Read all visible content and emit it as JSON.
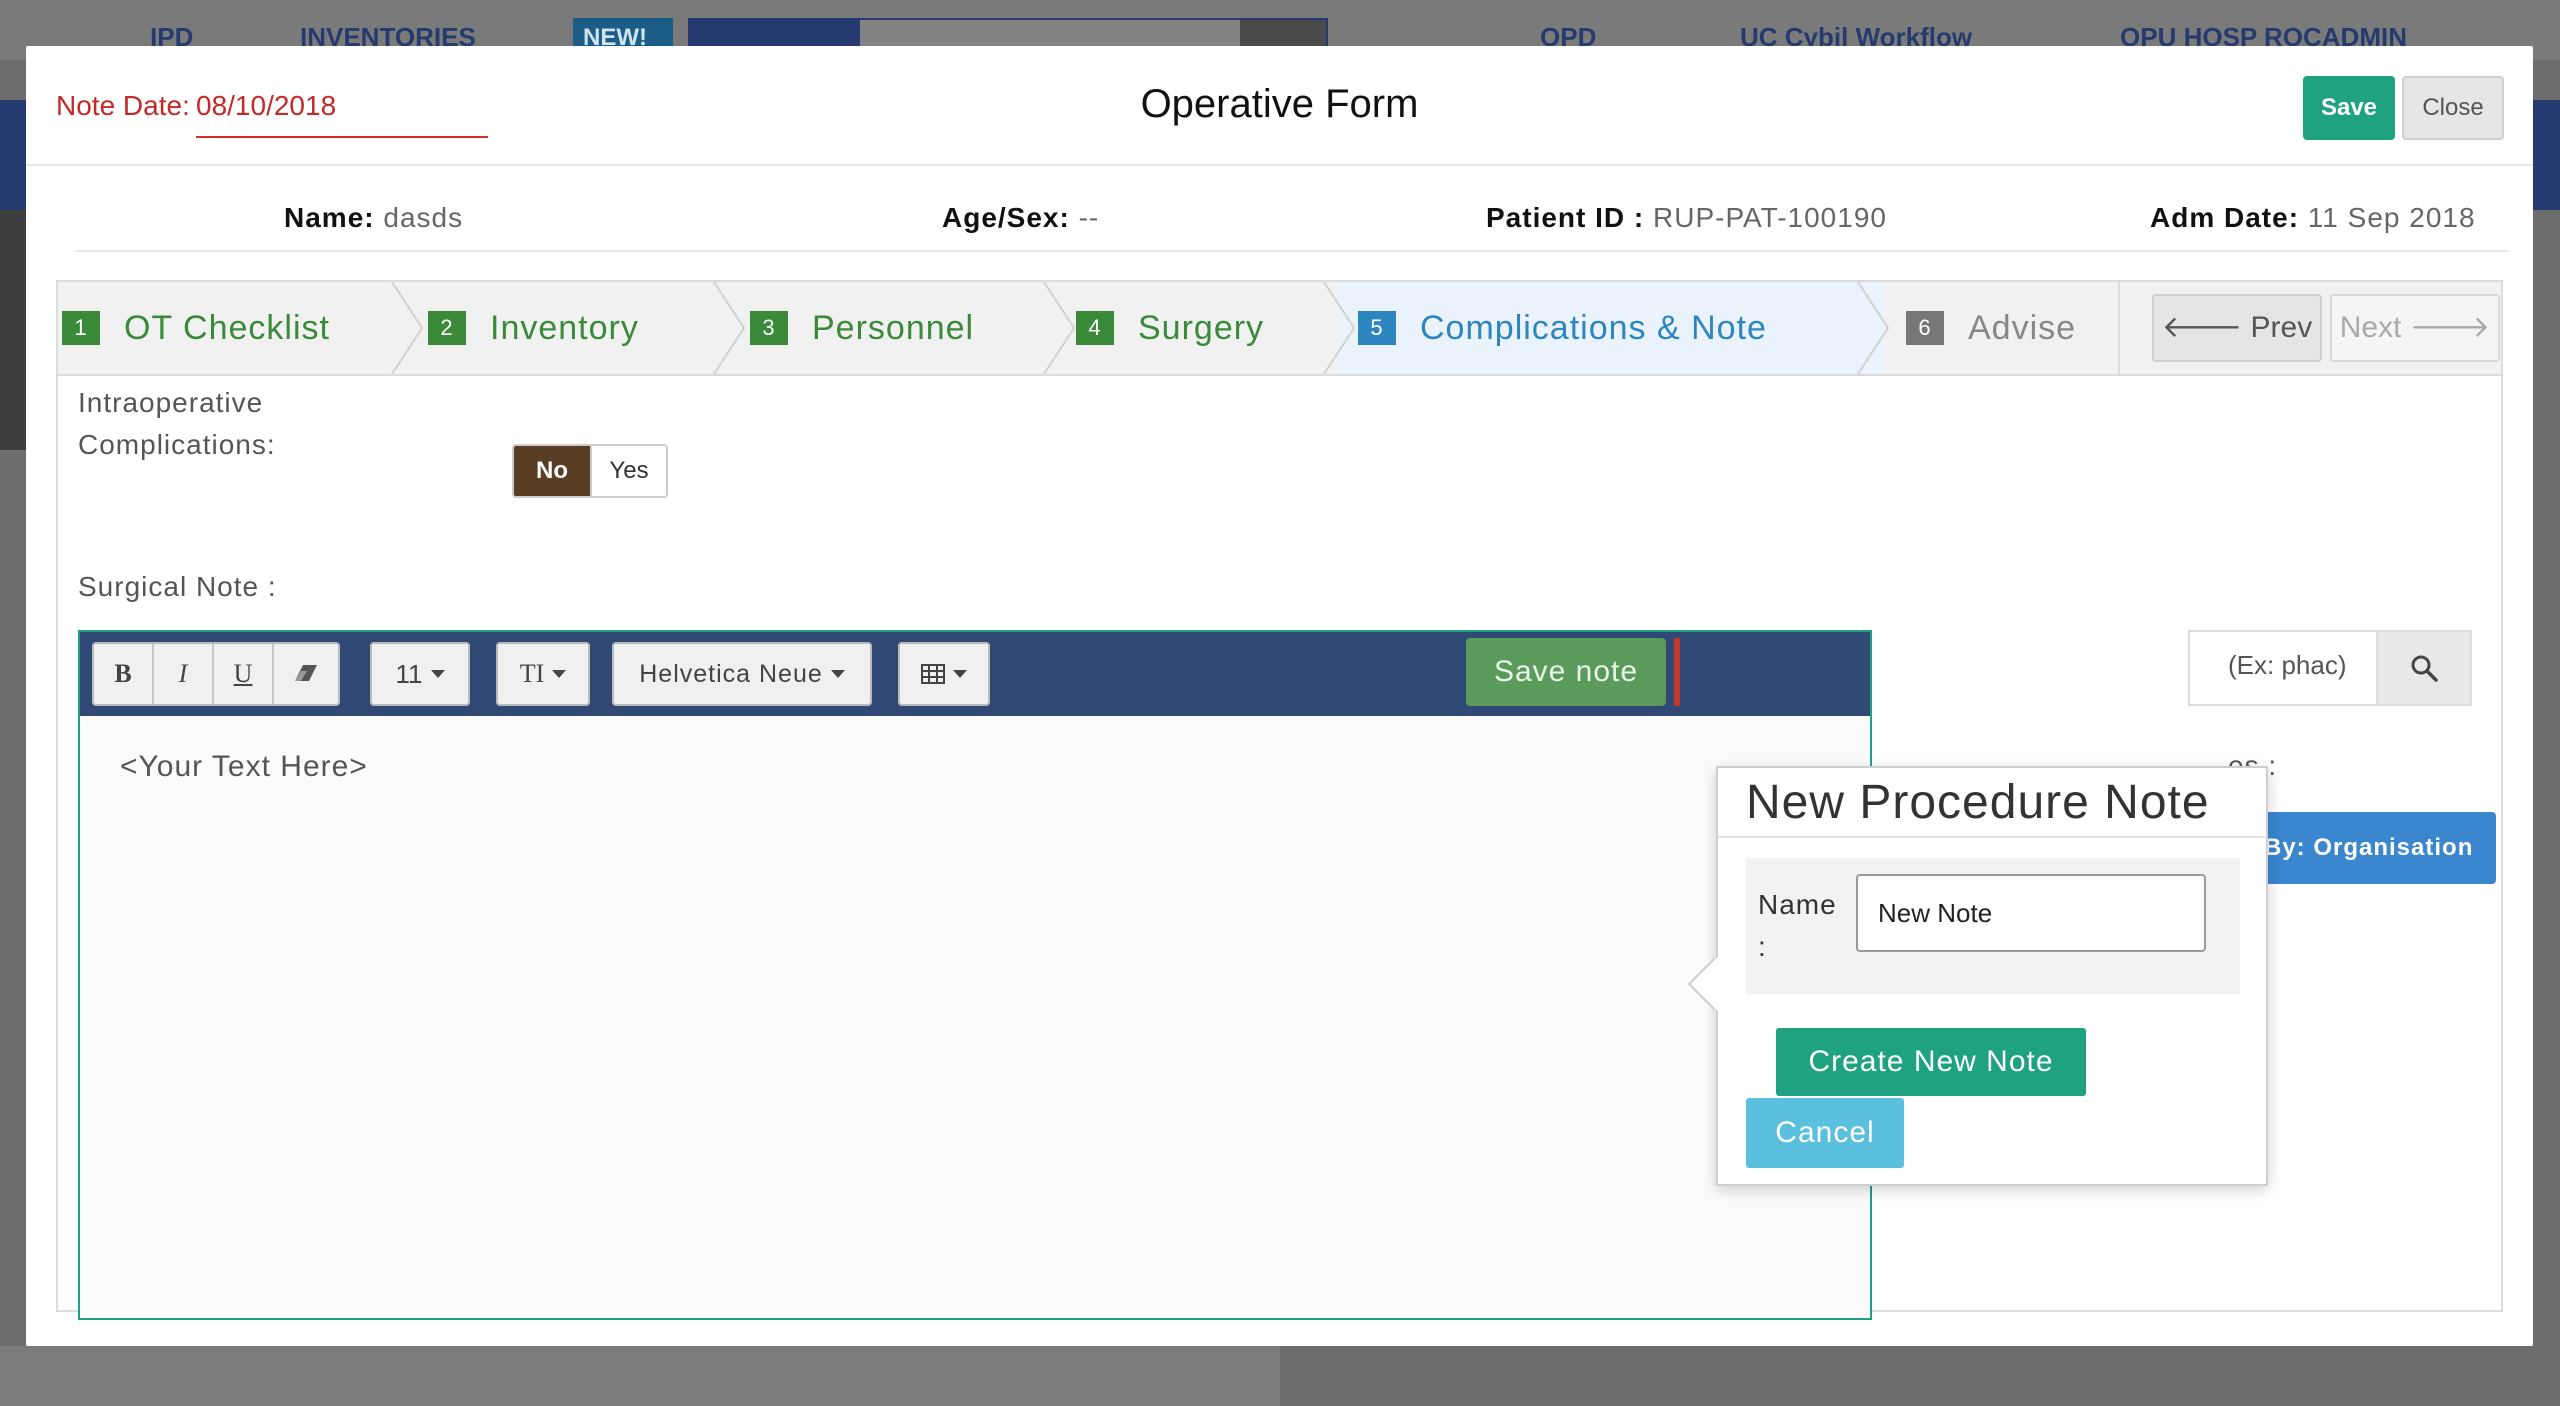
{
  "background": {
    "nav_items": [
      "IPD",
      "INVENTORIES",
      "OPD",
      "UC Cybil Workflow",
      "OPU HOSP ROCADMIN"
    ],
    "new_badge": "NEW!"
  },
  "modal": {
    "title": "Operative Form",
    "note_date_label": "Note Date:",
    "note_date_value": "08/10/2018",
    "save_label": "Save",
    "close_label": "Close"
  },
  "patient": {
    "name_label": "Name:",
    "name_value": "dasds",
    "agesex_label": "Age/Sex:",
    "agesex_value": "--",
    "pid_label": "Patient ID :",
    "pid_value": "RUP-PAT-100190",
    "adm_label": "Adm Date:",
    "adm_value": "11 Sep 2018"
  },
  "wizard": {
    "steps": [
      {
        "num": "1",
        "label": "OT Checklist"
      },
      {
        "num": "2",
        "label": "Inventory"
      },
      {
        "num": "3",
        "label": "Personnel"
      },
      {
        "num": "4",
        "label": "Surgery"
      },
      {
        "num": "5",
        "label": "Complications & Note"
      },
      {
        "num": "6",
        "label": "Advise"
      }
    ],
    "prev_label": "🡐 Prev",
    "next_label": "Next 🡒"
  },
  "form": {
    "complications_label_line1": "Intraoperative",
    "complications_label_line2": "Complications:",
    "toggle_no": "No",
    "toggle_yes": "Yes",
    "surgical_note_label": "Surgical Note :"
  },
  "editor": {
    "bold": "B",
    "italic": "I",
    "underline": "U",
    "font_size": "11",
    "text_style": "TI",
    "font_family": "Helvetica Neue",
    "save_note_label": "Save note",
    "placeholder_text": "<Your Text Here>"
  },
  "right_panel": {
    "search_placeholder": "(Ex: phac)",
    "label_fragment": "es :",
    "filter_button": "By: Organisation"
  },
  "popover": {
    "title": "New Procedure Note",
    "name_label_line1": "Name",
    "name_label_line2": ":",
    "name_value": "New Note",
    "create_label": "Create New Note",
    "cancel_label": "Cancel"
  },
  "colors": {
    "primary_green": "#1fa27f",
    "step_green": "#3a8a3a",
    "active_blue": "#2e86c1",
    "toolbar_navy": "#2f4874",
    "toggle_brown": "#5a3e24",
    "note_date_red": "#c62828"
  }
}
